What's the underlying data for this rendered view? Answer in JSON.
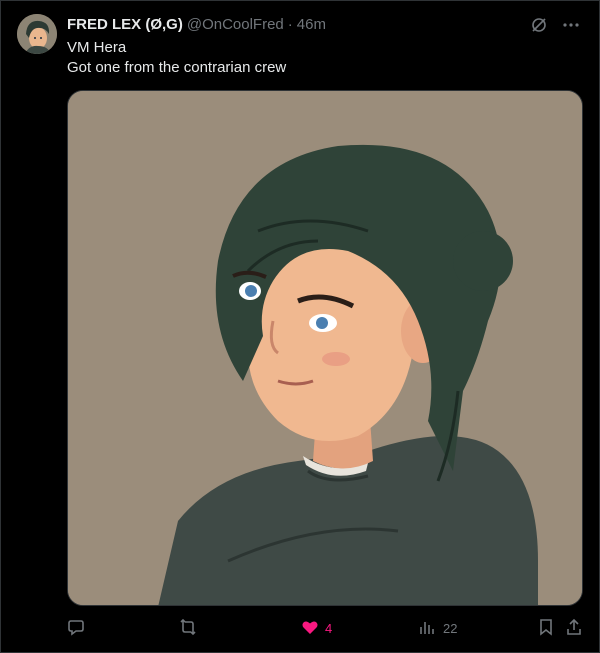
{
  "tweet": {
    "author": {
      "display_name": "FRED LEX (Ø,G)",
      "handle": "@OnCoolFred",
      "avatar_icon": "cartoon-avatar"
    },
    "separator": "·",
    "time": "46m",
    "lines": [
      "VM Hera",
      "Got one from the contrarian crew"
    ],
    "media": {
      "description_icon": "illustrated-portrait"
    },
    "actions": {
      "reply": {
        "icon": "reply-icon",
        "count": ""
      },
      "retweet": {
        "icon": "retweet-icon",
        "count": ""
      },
      "like": {
        "icon": "heart-icon",
        "count": "4",
        "liked": true
      },
      "views": {
        "icon": "views-icon",
        "count": "22"
      },
      "bookmark": {
        "icon": "bookmark-icon"
      },
      "share": {
        "icon": "share-icon"
      }
    },
    "top_icons": [
      "grok-icon",
      "more-icon"
    ]
  },
  "colors": {
    "background": "#000000",
    "text": "#e7e9ea",
    "muted": "#71767b",
    "like": "#f91880",
    "border": "#2f3336"
  }
}
